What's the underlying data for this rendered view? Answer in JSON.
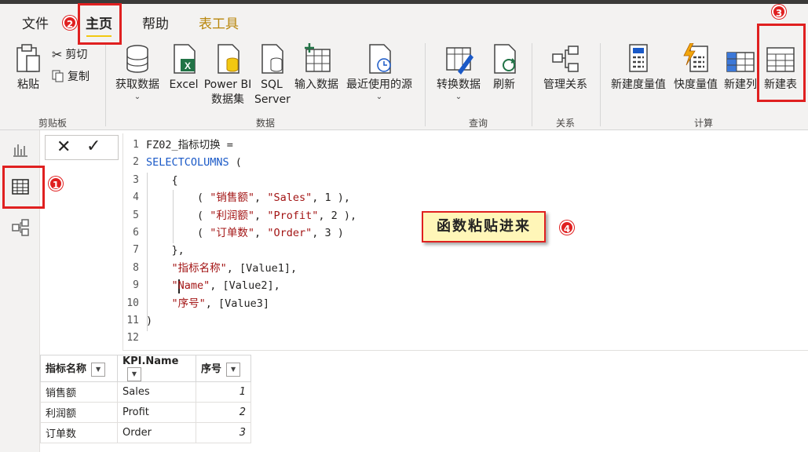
{
  "tabs": [
    {
      "label": "文件"
    },
    {
      "label": "主页"
    },
    {
      "label": "帮助"
    },
    {
      "label": "表工具"
    }
  ],
  "ribbon": {
    "clipboard": {
      "paste": "粘贴",
      "cut": "剪切",
      "copy": "复制",
      "group": "剪贴板"
    },
    "data": {
      "get_data": "获取数据",
      "excel": "Excel",
      "powerbi_line1": "Power BI",
      "powerbi_line2": "数据集",
      "sql_line1": "SQL",
      "sql_line2": "Server",
      "enter_data": "输入数据",
      "recent": "最近使用的源",
      "group": "数据"
    },
    "query": {
      "transform": "转换数据",
      "refresh": "刷新",
      "group": "查询"
    },
    "relations": {
      "manage": "管理关系",
      "group": "关系"
    },
    "calc": {
      "new_measure": "新建度量值",
      "quick_measure": "快度量值",
      "new_column": "新建列",
      "new_table": "新建表",
      "group": "计算"
    }
  },
  "formula": {
    "lines": [
      {
        "n": "1",
        "parts": [
          {
            "t": "FZ02_指标切换 =",
            "c": ""
          }
        ]
      },
      {
        "n": "2",
        "parts": [
          {
            "t": "SELECTCOLUMNS",
            "c": "kw"
          },
          {
            "t": " (",
            "c": ""
          }
        ]
      },
      {
        "n": "3",
        "parts": [
          {
            "t": "    {",
            "c": ""
          }
        ]
      },
      {
        "n": "4",
        "parts": [
          {
            "t": "        ( ",
            "c": ""
          },
          {
            "t": "\"销售额\"",
            "c": "str"
          },
          {
            "t": ", ",
            "c": ""
          },
          {
            "t": "\"Sales\"",
            "c": "str"
          },
          {
            "t": ", 1 ),",
            "c": ""
          }
        ]
      },
      {
        "n": "5",
        "parts": [
          {
            "t": "        ( ",
            "c": ""
          },
          {
            "t": "\"利润额\"",
            "c": "str"
          },
          {
            "t": ", ",
            "c": ""
          },
          {
            "t": "\"Profit\"",
            "c": "str"
          },
          {
            "t": ", 2 ),",
            "c": ""
          }
        ]
      },
      {
        "n": "6",
        "parts": [
          {
            "t": "        ( ",
            "c": ""
          },
          {
            "t": "\"订单数\"",
            "c": "str"
          },
          {
            "t": ", ",
            "c": ""
          },
          {
            "t": "\"Order\"",
            "c": "str"
          },
          {
            "t": ", 3 )",
            "c": ""
          }
        ]
      },
      {
        "n": "7",
        "parts": [
          {
            "t": "    },",
            "c": ""
          }
        ]
      },
      {
        "n": "8",
        "parts": [
          {
            "t": "    ",
            "c": ""
          },
          {
            "t": "\"指标名称\"",
            "c": "str"
          },
          {
            "t": ", [Value1],",
            "c": ""
          }
        ]
      },
      {
        "n": "9",
        "parts": [
          {
            "t": "    ",
            "c": ""
          },
          {
            "t": "\"Name\"",
            "c": "str"
          },
          {
            "t": ", [Value2],",
            "c": ""
          }
        ]
      },
      {
        "n": "10",
        "parts": [
          {
            "t": "    ",
            "c": ""
          },
          {
            "t": "\"序号\"",
            "c": "str"
          },
          {
            "t": ", [Value3]",
            "c": ""
          }
        ]
      },
      {
        "n": "11",
        "parts": [
          {
            "t": ")",
            "c": ""
          }
        ]
      },
      {
        "n": "12",
        "parts": [
          {
            "t": "",
            "c": ""
          }
        ]
      }
    ]
  },
  "callout": {
    "text": "函数粘贴进来"
  },
  "badges": [
    "1",
    "2",
    "3",
    "4"
  ],
  "table": {
    "headers": [
      "指标名称",
      "KPI.Name",
      "序号"
    ],
    "rows": [
      [
        "销售额",
        "Sales",
        "1"
      ],
      [
        "利润额",
        "Profit",
        "2"
      ],
      [
        "订单数",
        "Order",
        "3"
      ]
    ]
  },
  "colors": {
    "accent": "#f2c811",
    "annotation": "#e02020",
    "keyword": "#1a59c7",
    "string": "#a31515"
  }
}
